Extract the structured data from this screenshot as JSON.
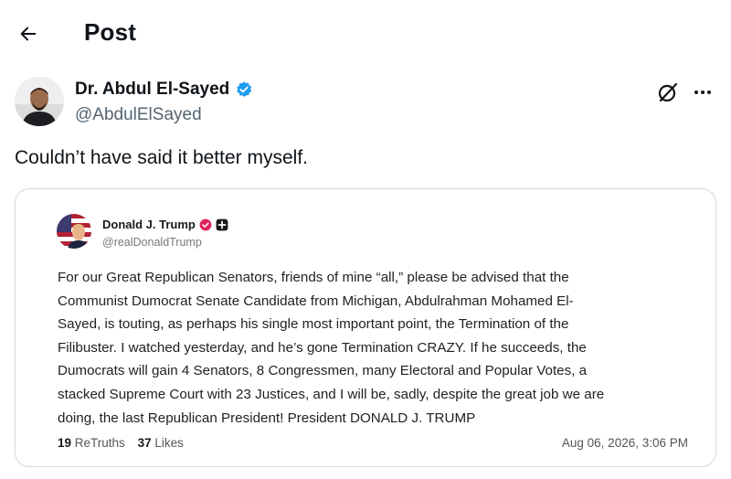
{
  "header": {
    "title": "Post",
    "back_icon": "back-arrow-icon"
  },
  "author": {
    "name": "Dr. Abdul El-Sayed",
    "handle": "@AbdulElSayed",
    "verified_color": "#1d9bf0"
  },
  "post": {
    "text": "Couldn’t have said it better myself."
  },
  "quoted": {
    "name": "Donald J. Trump",
    "handle": "@realDonaldTrump",
    "badge_color": "#e0245e",
    "lines": [
      "For our Great Republican Senators, friends of mine “all,” please be advised that the",
      "Communist Dumocrat Senate Candidate from Michigan, Abdulrahman Mohamed El-",
      "Sayed, is touting, as perhaps his single most important point, the Termination of the",
      "Filibuster. I watched yesterday, and he’s gone Termination CRAZY. If he succeeds, the",
      "Dumocrats will gain 4 Senators, 8 Congressmen, many Electoral and Popular Votes, a",
      "stacked Supreme Court with 23 Justices, and I will be, sadly, despite the great job we are",
      "doing, the last Republican President! President DONALD J. TRUMP"
    ],
    "retruths_count": "19",
    "retruths_label": "ReTruths",
    "likes_count": "37",
    "likes_label": "Likes",
    "date": "Aug 06, 2026, 3:06 PM"
  }
}
